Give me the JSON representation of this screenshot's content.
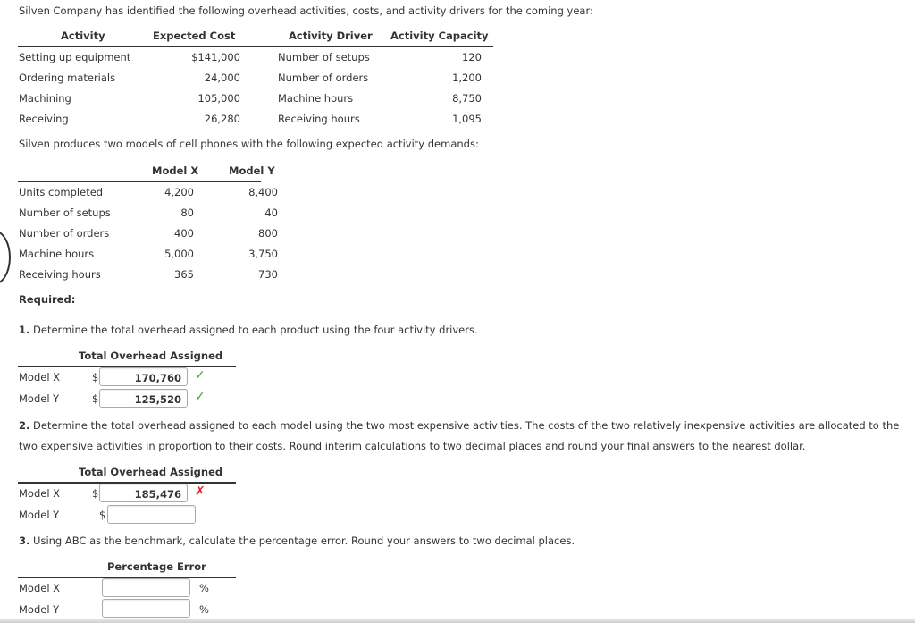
{
  "intro": "Silven Company has identified the following overhead activities, costs, and activity drivers for the coming year:",
  "activities_table": {
    "headers": [
      "Activity",
      "Expected Cost",
      "Activity Driver",
      "Activity Capacity"
    ],
    "rows": [
      {
        "activity": "Setting up equipment",
        "cost": "$141,000",
        "driver": "Number of setups",
        "capacity": "120"
      },
      {
        "activity": "Ordering materials",
        "cost": "24,000",
        "driver": "Number of orders",
        "capacity": "1,200"
      },
      {
        "activity": "Machining",
        "cost": "105,000",
        "driver": "Machine hours",
        "capacity": "8,750"
      },
      {
        "activity": "Receiving",
        "cost": "26,280",
        "driver": "Receiving hours",
        "capacity": "1,095"
      }
    ]
  },
  "demands_intro": "Silven produces two models of cell phones with the following expected activity demands:",
  "demands_table": {
    "headers": [
      "Model X",
      "Model Y"
    ],
    "rows": [
      {
        "label": "Units completed",
        "x": "4,200",
        "y": "8,400"
      },
      {
        "label": "Number of setups",
        "x": "80",
        "y": "40"
      },
      {
        "label": "Number of orders",
        "x": "400",
        "y": "800"
      },
      {
        "label": "Machine hours",
        "x": "5,000",
        "y": "3,750"
      },
      {
        "label": "Receiving hours",
        "x": "365",
        "y": "730"
      }
    ]
  },
  "required_label": "Required:",
  "q1": {
    "number": "1.",
    "text": " Determine the total overhead assigned to each product using the four activity drivers.",
    "header": "Total Overhead Assigned",
    "rows": [
      {
        "label": "Model X",
        "currency": "$",
        "value": "170,760",
        "status": "correct"
      },
      {
        "label": "Model Y",
        "currency": "$",
        "value": "125,520",
        "status": "correct"
      }
    ]
  },
  "q2": {
    "number": "2.",
    "text_line1": " Determine the total overhead assigned to each model using the two most expensive activities. The costs of the two relatively inexpensive activities are allocated to the",
    "text_line2": "two expensive activities in proportion to their costs. Round interim calculations to two decimal places and round your final answers to the nearest dollar.",
    "header": "Total Overhead Assigned",
    "rows": [
      {
        "label": "Model X",
        "currency": "$",
        "value": "185,476",
        "status": "incorrect"
      },
      {
        "label": "Model Y",
        "currency": "$",
        "value": "",
        "status": ""
      }
    ]
  },
  "q3": {
    "number": "3.",
    "text": " Using ABC as the benchmark, calculate the percentage error. Round your answers to two decimal places.",
    "header": "Percentage Error",
    "rows": [
      {
        "label": "Model X",
        "value": "",
        "unit": "%"
      },
      {
        "label": "Model Y",
        "value": "",
        "unit": "%"
      }
    ]
  },
  "status_icons": {
    "correct": "✓",
    "incorrect": "✗"
  },
  "colors": {
    "correct": "#3aa63a",
    "incorrect": "#e0202a",
    "text": "#333333"
  }
}
